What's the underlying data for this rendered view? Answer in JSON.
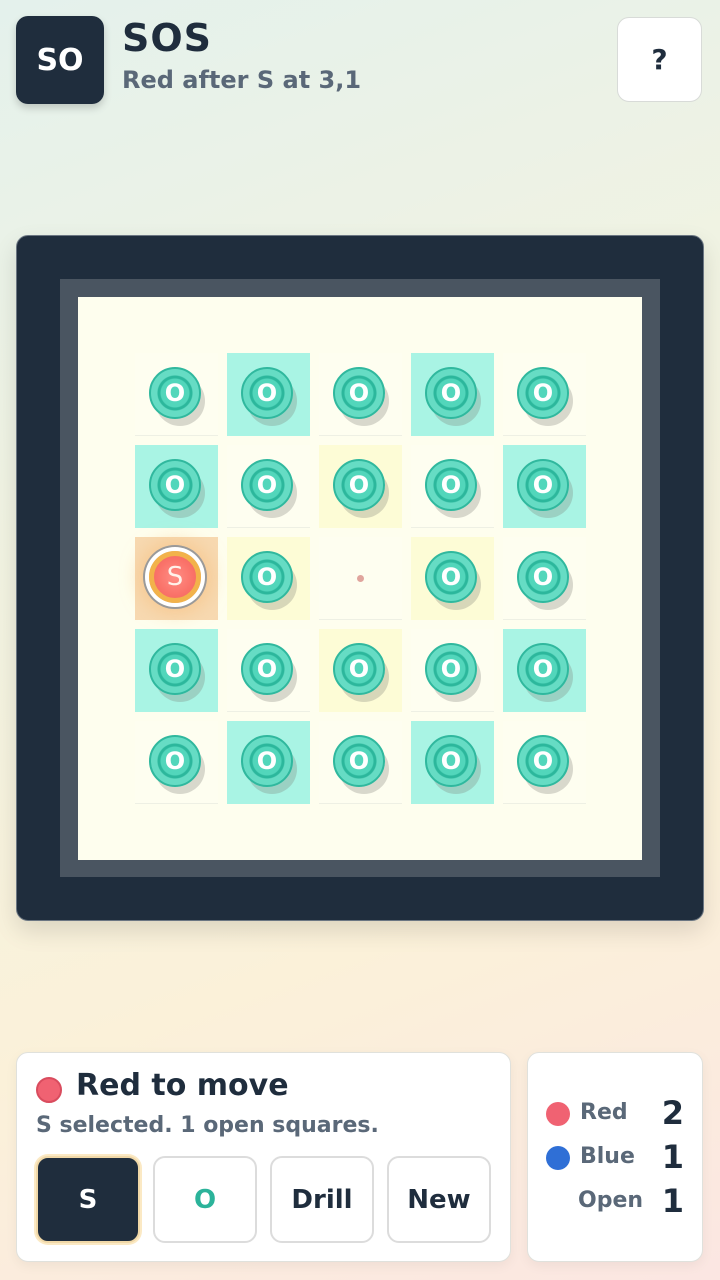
{
  "header": {
    "logo_text": "SO",
    "title": "SOS",
    "subtitle": "Red after S at 3,1",
    "help_label": "?"
  },
  "board": {
    "rows": [
      [
        {
          "letter": "O",
          "highlight": "none"
        },
        {
          "letter": "O",
          "highlight": "teal"
        },
        {
          "letter": "O",
          "highlight": "none"
        },
        {
          "letter": "O",
          "highlight": "teal"
        },
        {
          "letter": "O",
          "highlight": "none"
        }
      ],
      [
        {
          "letter": "O",
          "highlight": "teal"
        },
        {
          "letter": "O",
          "highlight": "none"
        },
        {
          "letter": "O",
          "highlight": "yellow"
        },
        {
          "letter": "O",
          "highlight": "none"
        },
        {
          "letter": "O",
          "highlight": "teal"
        }
      ],
      [
        {
          "letter": "S",
          "highlight": "peach",
          "last_move": true
        },
        {
          "letter": "O",
          "highlight": "yellow"
        },
        {
          "letter": "",
          "highlight": "none",
          "open": true
        },
        {
          "letter": "O",
          "highlight": "yellow"
        },
        {
          "letter": "O",
          "highlight": "none"
        }
      ],
      [
        {
          "letter": "O",
          "highlight": "teal"
        },
        {
          "letter": "O",
          "highlight": "none"
        },
        {
          "letter": "O",
          "highlight": "yellow"
        },
        {
          "letter": "O",
          "highlight": "none"
        },
        {
          "letter": "O",
          "highlight": "teal"
        }
      ],
      [
        {
          "letter": "O",
          "highlight": "none"
        },
        {
          "letter": "O",
          "highlight": "teal"
        },
        {
          "letter": "O",
          "highlight": "none"
        },
        {
          "letter": "O",
          "highlight": "teal"
        },
        {
          "letter": "O",
          "highlight": "none"
        }
      ]
    ]
  },
  "status": {
    "turn_text": "Red to move",
    "turn_color": "#f06272",
    "detail": "S selected. 1 open squares."
  },
  "controls": {
    "s_label": "S",
    "o_label": "O",
    "drill_label": "Drill",
    "new_label": "New",
    "selected": "S"
  },
  "score": {
    "red_label": "Red",
    "red_value": "2",
    "red_color": "#f06272",
    "blue_label": "Blue",
    "blue_value": "1",
    "blue_color": "#2f6fd6",
    "open_label": "Open",
    "open_value": "1"
  },
  "colors": {
    "o_chip": "#52d6bb",
    "s_chip": "#fa7269",
    "highlight_teal": "#a9f4e4",
    "highlight_yellow": "#fdfcd6",
    "highlight_peach": "#f7d9b1"
  }
}
